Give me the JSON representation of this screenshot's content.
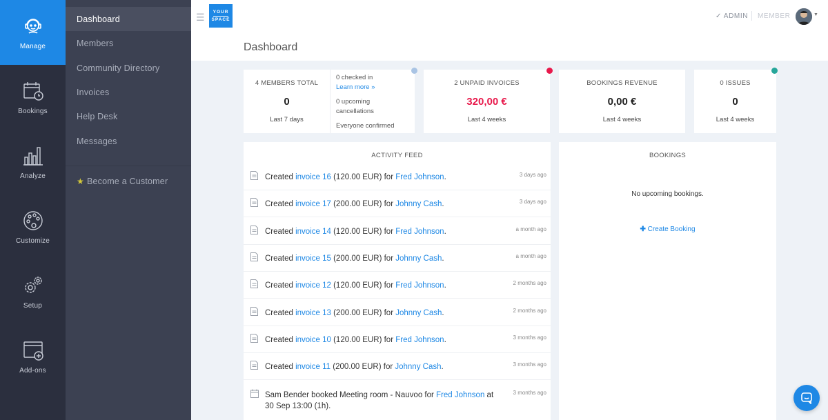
{
  "rail": {
    "items": [
      {
        "label": "Manage",
        "icon": "user-headset-icon",
        "active": true
      },
      {
        "label": "Bookings",
        "icon": "calendar-clock-icon"
      },
      {
        "label": "Analyze",
        "icon": "bar-chart-icon"
      },
      {
        "label": "Customize",
        "icon": "palette-icon"
      },
      {
        "label": "Setup",
        "icon": "gears-icon"
      },
      {
        "label": "Add-ons",
        "icon": "window-plus-icon"
      }
    ]
  },
  "subnav": {
    "items": [
      {
        "label": "Dashboard",
        "active": true
      },
      {
        "label": "Members"
      },
      {
        "label": "Community Directory"
      },
      {
        "label": "Invoices"
      },
      {
        "label": "Help Desk"
      },
      {
        "label": "Messages"
      }
    ],
    "become_customer": "Become a Customer"
  },
  "header": {
    "logo_line1": "YOUR",
    "logo_line2": "SPACE",
    "page_title": "Dashboard",
    "role_admin": "✓ ADMIN",
    "role_member": "MEMBER"
  },
  "stats": {
    "members": {
      "label": "4 MEMBERS TOTAL",
      "value": "0",
      "sub": "Last 7 days",
      "checked_in": "0 checked in",
      "learn_more": "Learn more »",
      "cancellations_1": "0 upcoming",
      "cancellations_2": "cancellations",
      "confirmed": "Everyone confirmed",
      "dot_color": "#a9c4e4"
    },
    "invoices": {
      "label": "2 UNPAID INVOICES",
      "value": "320,00 €",
      "sub": "Last 4 weeks",
      "dot_color": "#e8194b",
      "value_color": "#e8194b"
    },
    "revenue": {
      "label": "BOOKINGS REVENUE",
      "value": "0,00 €",
      "sub": "Last 4 weeks"
    },
    "issues": {
      "label": "0 ISSUES",
      "value": "0",
      "sub": "Last 4 weeks",
      "dot_color": "#26a69a"
    }
  },
  "feed": {
    "title": "ACTIVITY FEED",
    "rows": [
      {
        "pre": "Created ",
        "link1": "invoice 16",
        "mid": " (120.00 EUR) for ",
        "link2": "Fred Johnson",
        "post": ".",
        "time": "3 days ago"
      },
      {
        "pre": "Created ",
        "link1": "invoice 17",
        "mid": " (200.00 EUR) for ",
        "link2": "Johnny Cash",
        "post": ".",
        "time": "3 days ago"
      },
      {
        "pre": "Created ",
        "link1": "invoice 14",
        "mid": " (120.00 EUR) for ",
        "link2": "Fred Johnson",
        "post": ".",
        "time": "a month ago"
      },
      {
        "pre": "Created ",
        "link1": "invoice 15",
        "mid": " (200.00 EUR) for ",
        "link2": "Johnny Cash",
        "post": ".",
        "time": "a month ago"
      },
      {
        "pre": "Created ",
        "link1": "invoice 12",
        "mid": " (120.00 EUR) for ",
        "link2": "Fred Johnson",
        "post": ".",
        "time": "2 months ago"
      },
      {
        "pre": "Created ",
        "link1": "invoice 13",
        "mid": " (200.00 EUR) for ",
        "link2": "Johnny Cash",
        "post": ".",
        "time": "2 months ago"
      },
      {
        "pre": "Created ",
        "link1": "invoice 10",
        "mid": " (120.00 EUR) for ",
        "link2": "Fred Johnson",
        "post": ".",
        "time": "3 months ago"
      },
      {
        "pre": "Created ",
        "link1": "invoice 11",
        "mid": " (200.00 EUR) for ",
        "link2": "Johnny Cash",
        "post": ".",
        "time": "3 months ago"
      }
    ],
    "booking_row": {
      "pre": "Sam Bender booked Meeting room - Nauvoo for ",
      "link": "Fred Johnson",
      "post": " at 30 Sep 13:00 (1h).",
      "time": "3 months ago"
    }
  },
  "bookings": {
    "title": "BOOKINGS",
    "empty": "No upcoming bookings.",
    "create": "Create Booking"
  },
  "chat": {
    "icon": "chat-bubble-icon"
  }
}
